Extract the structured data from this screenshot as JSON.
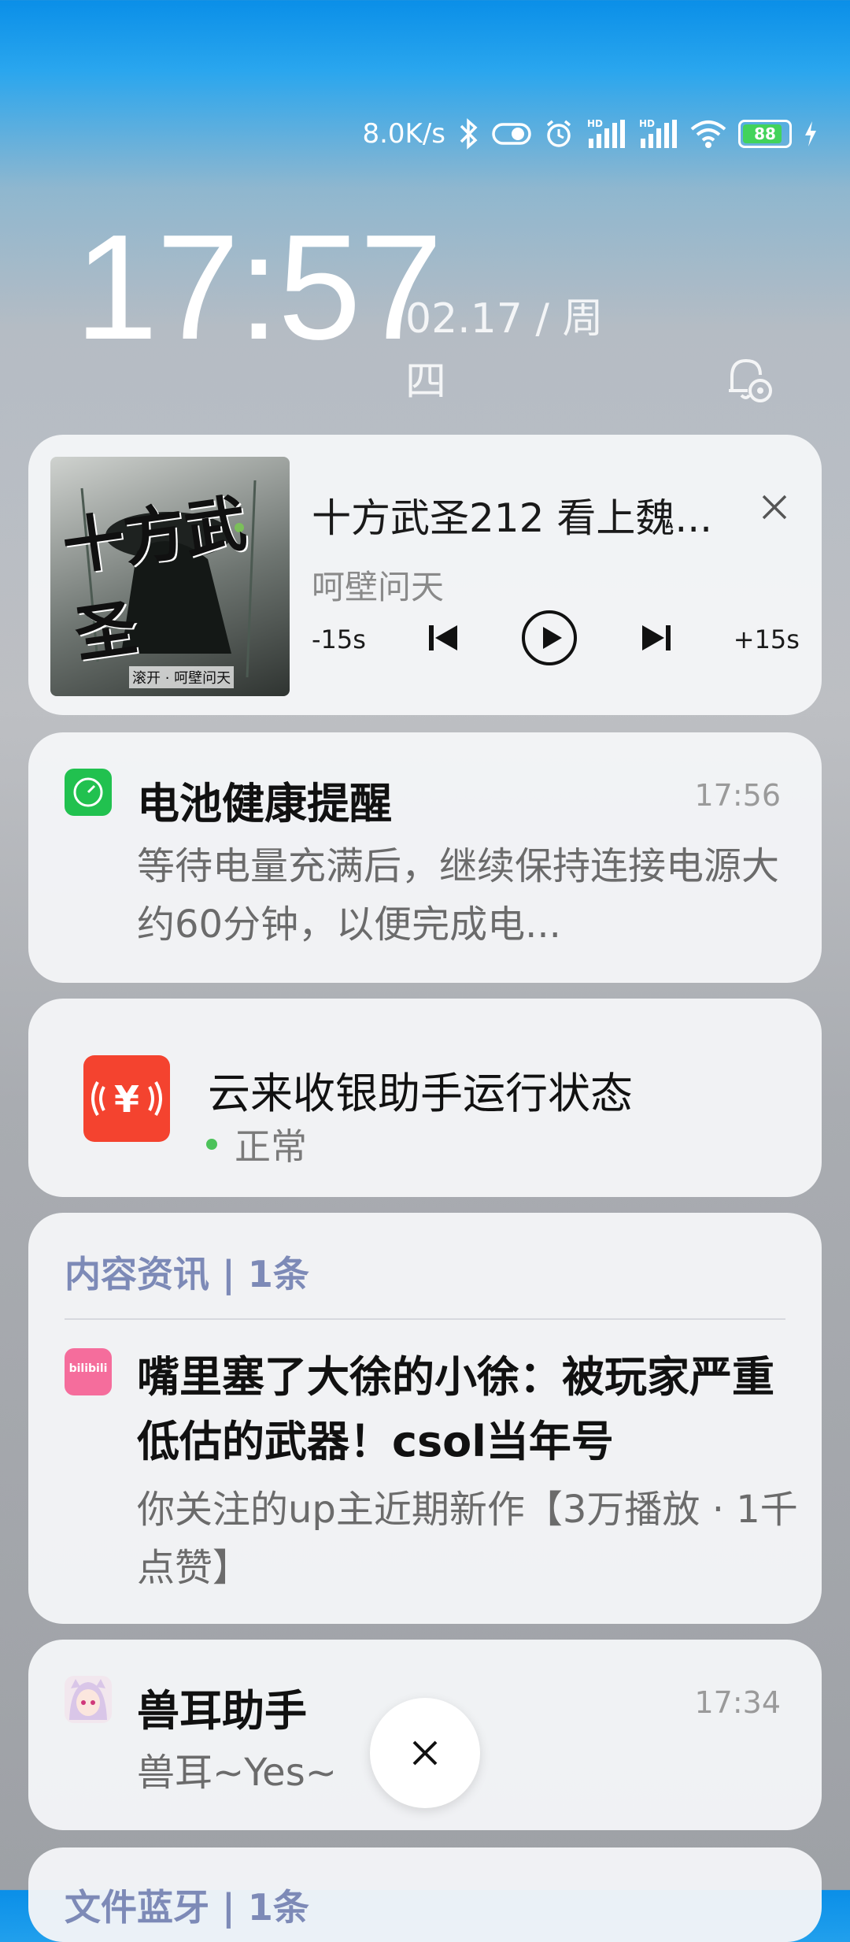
{
  "status_bar": {
    "net_speed": "8.0K/s",
    "signal_1_label": "HD",
    "signal_2_label": "HD",
    "battery": "88",
    "icons": [
      "bluetooth-icon",
      "vibrate-toggle-icon",
      "alarm-icon",
      "signal-icon",
      "signal-icon",
      "wifi-icon",
      "battery-icon",
      "charging-icon"
    ]
  },
  "lockscreen": {
    "time": "17:57",
    "date": "02.17 / 周四",
    "settings_icon": "notification-settings-icon"
  },
  "media": {
    "cover_text": "十方武圣",
    "cover_sub": "滚开 · 呵壁问天",
    "title": "十方武圣212 看上魏...",
    "artist": "呵壁问天",
    "rewind": "-15s",
    "forward": "+15s",
    "close_icon": "close-icon"
  },
  "notifications": [
    {
      "title": "电池健康提醒",
      "time": "17:56",
      "body": "等待电量充满后，继续保持连接电源大约60分钟，以便完成电...",
      "icon_color": "#21c14f"
    },
    {
      "title": "云来收银助手运行状态",
      "status": "正常",
      "status_color": "#4cc25a",
      "icon_color": "#f4432f"
    },
    {
      "group": "内容资讯 | 1条",
      "title": "嘴里塞了大徐的小徐：被玩家严重低估的武器！csol当年号",
      "body": "你关注的up主近期新作【3万播放 · 1千点赞】",
      "icon_color": "#f56d9c",
      "icon_text": "bilibili"
    },
    {
      "title": "兽耳助手",
      "time": "17:34",
      "body": "兽耳~Yes~"
    },
    {
      "group": "文件蓝牙 | 1条"
    }
  ]
}
